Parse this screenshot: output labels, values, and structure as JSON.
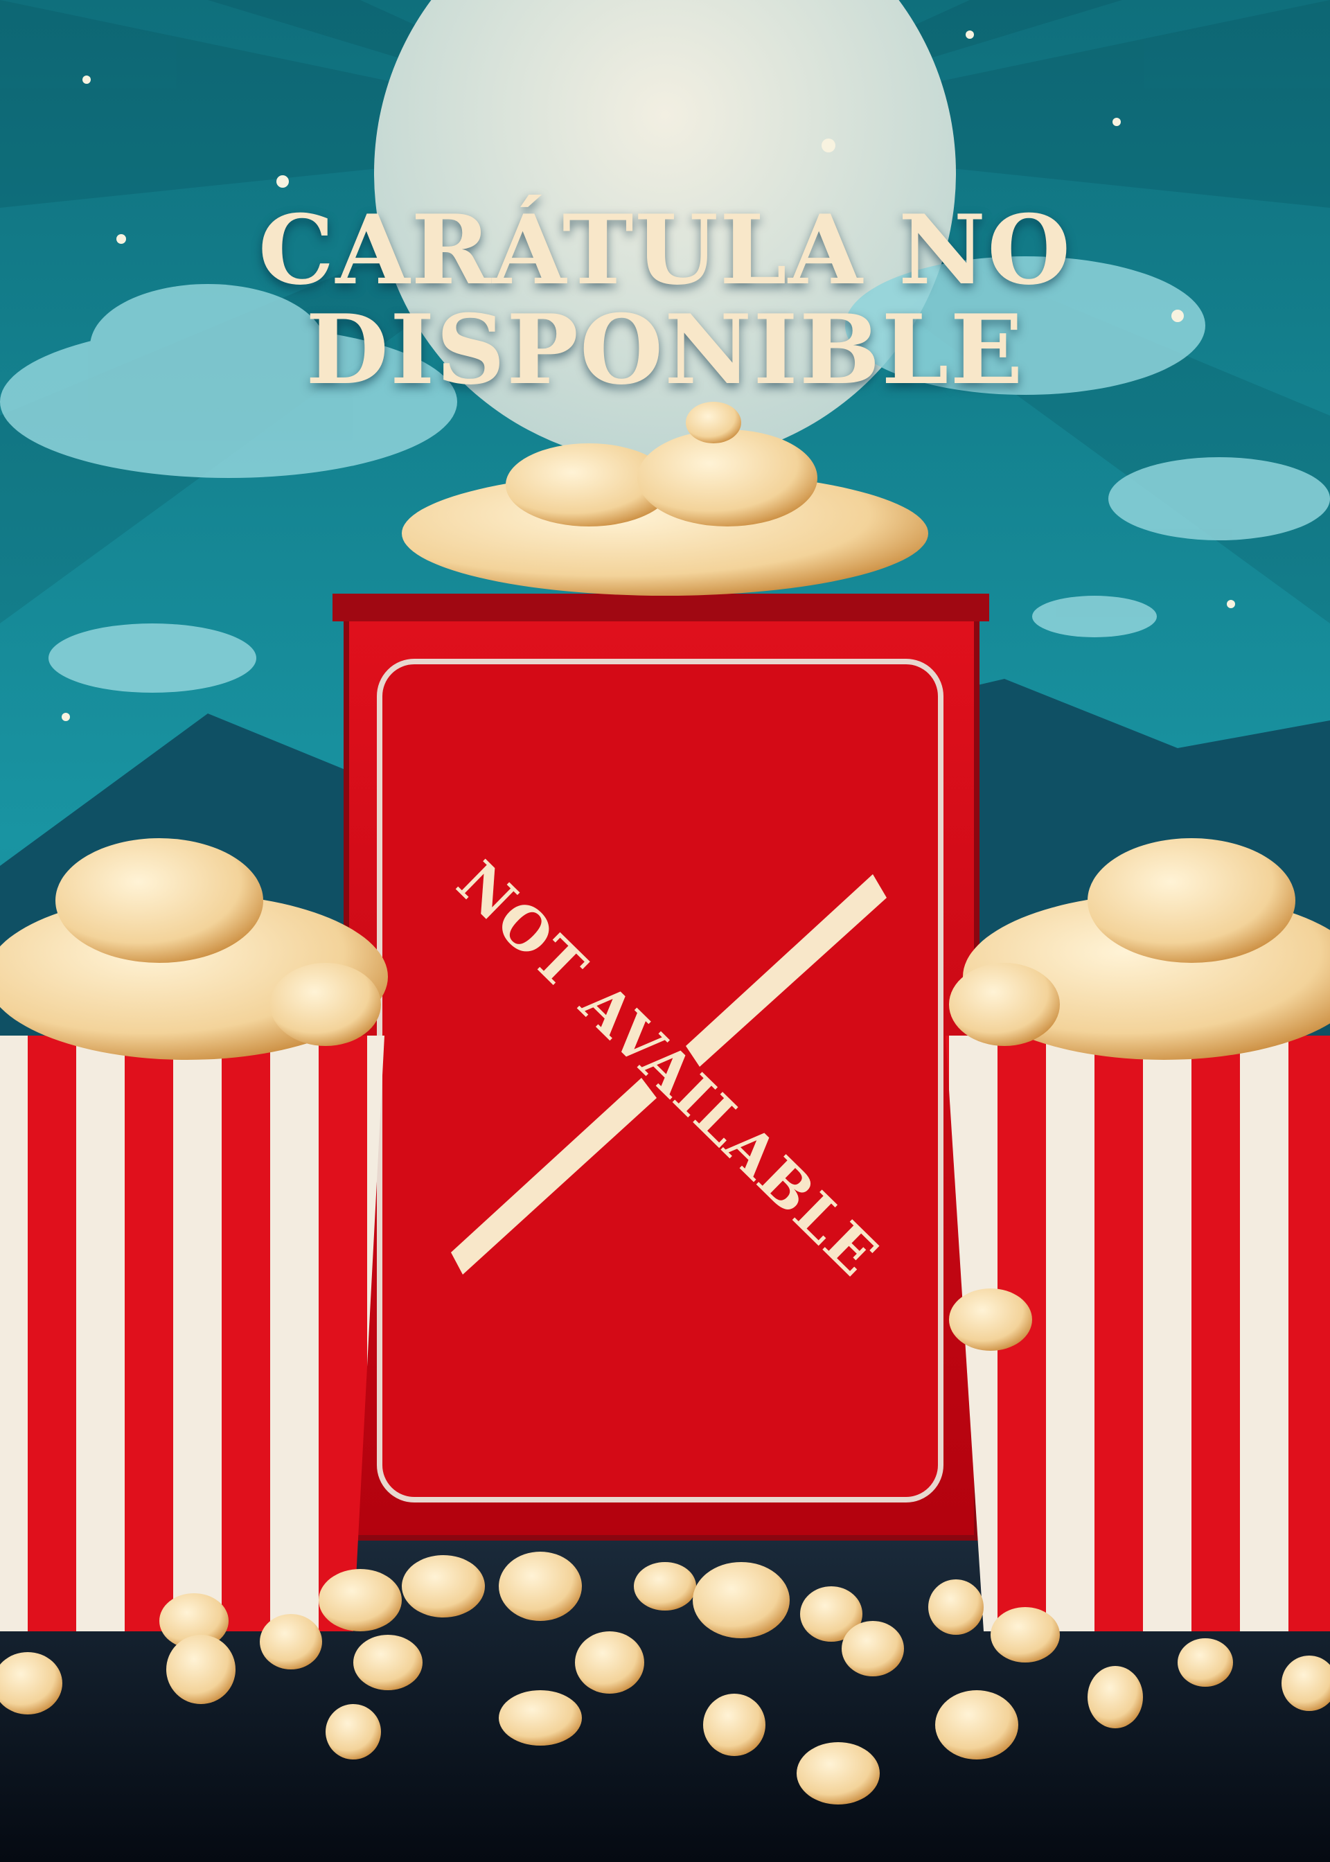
{
  "poster": {
    "title_line1": "CARÁTULA NO",
    "title_line2": "DISPONIBLE",
    "stamp_text": "NOT AVAILABLE",
    "colors": {
      "sky": "#1a8a9a",
      "red": "#d80a16",
      "cream": "#f8e7c9",
      "floor": "#0b1622"
    }
  }
}
